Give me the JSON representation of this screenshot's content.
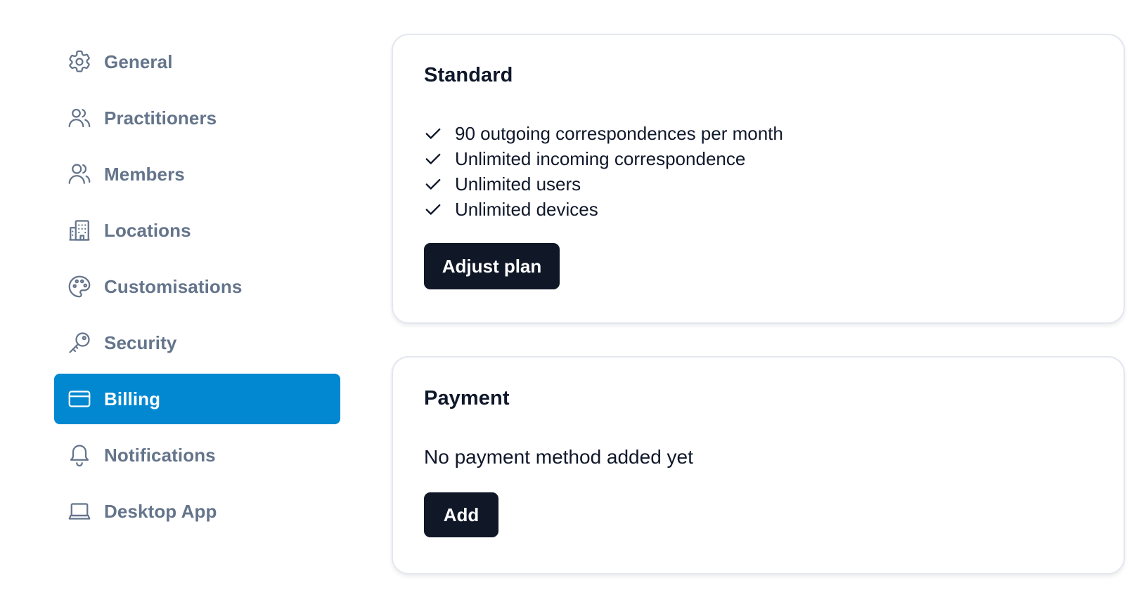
{
  "sidebar": {
    "items": [
      {
        "label": "General",
        "icon": "gear-icon",
        "active": false
      },
      {
        "label": "Practitioners",
        "icon": "users-icon",
        "active": false
      },
      {
        "label": "Members",
        "icon": "user-group-icon",
        "active": false
      },
      {
        "label": "Locations",
        "icon": "building-icon",
        "active": false
      },
      {
        "label": "Customisations",
        "icon": "palette-icon",
        "active": false
      },
      {
        "label": "Security",
        "icon": "key-icon",
        "active": false
      },
      {
        "label": "Billing",
        "icon": "credit-card-icon",
        "active": true
      },
      {
        "label": "Notifications",
        "icon": "bell-icon",
        "active": false
      },
      {
        "label": "Desktop App",
        "icon": "laptop-icon",
        "active": false
      }
    ]
  },
  "plan": {
    "title": "Standard",
    "features": [
      "90 outgoing correspondences per month",
      "Unlimited incoming correspondence",
      "Unlimited users",
      "Unlimited devices"
    ],
    "button_label": "Adjust plan"
  },
  "payment": {
    "title": "Payment",
    "empty_text": "No payment method added yet",
    "button_label": "Add"
  },
  "colors": {
    "accent": "#0288d1",
    "button": "#101827",
    "nav_text": "#64748b",
    "text": "#0f172a"
  }
}
